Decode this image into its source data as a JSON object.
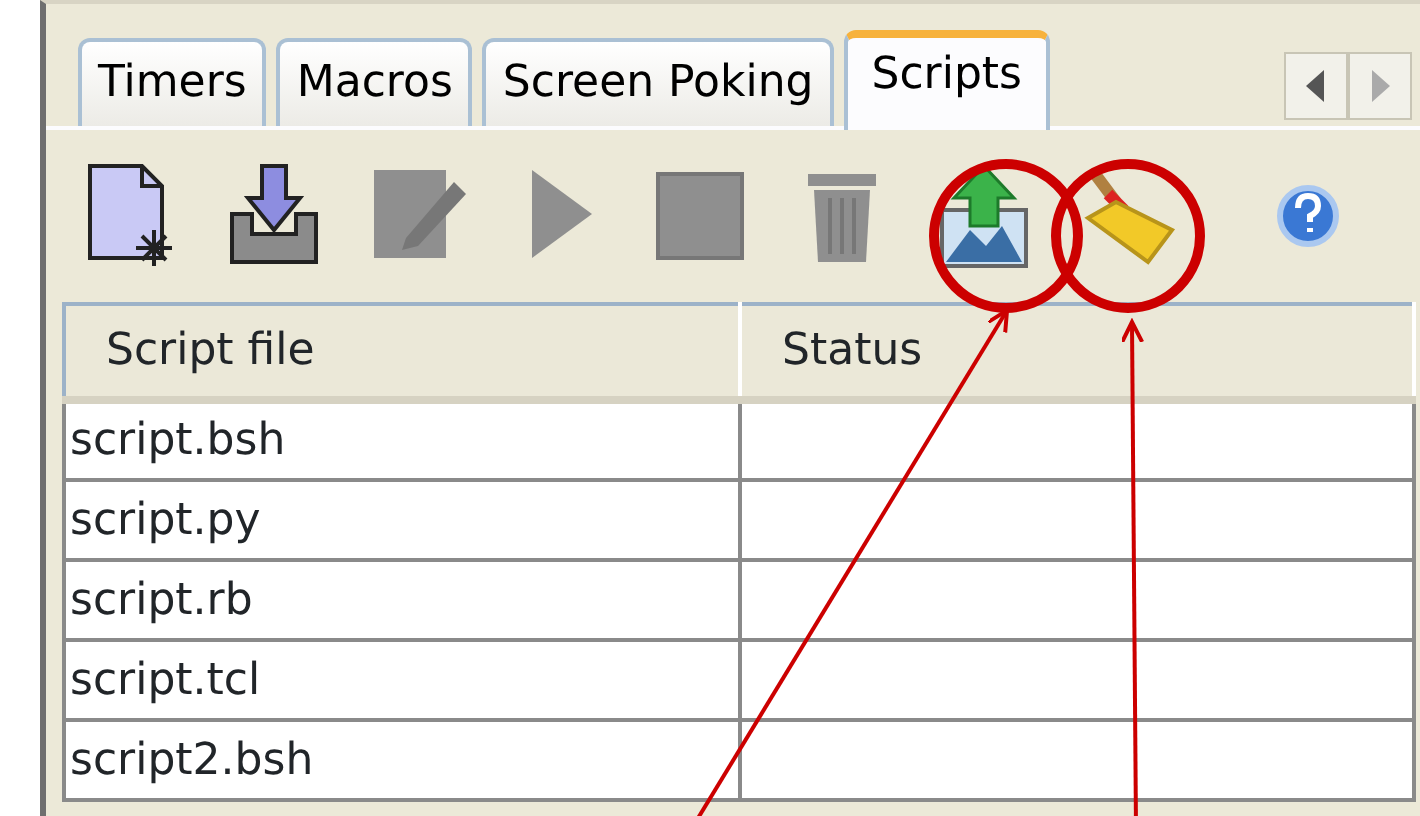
{
  "tabs": [
    {
      "label": "Timers",
      "selected": false
    },
    {
      "label": "Macros",
      "selected": false
    },
    {
      "label": "Screen Poking",
      "selected": false
    },
    {
      "label": "Scripts",
      "selected": true
    }
  ],
  "toolbar": [
    {
      "kind": "new",
      "disabled": false
    },
    {
      "kind": "import",
      "disabled": false
    },
    {
      "kind": "edit",
      "disabled": true
    },
    {
      "kind": "run",
      "disabled": true
    },
    {
      "kind": "stop",
      "disabled": true
    },
    {
      "kind": "delete",
      "disabled": true
    },
    {
      "kind": "upload",
      "disabled": false
    },
    {
      "kind": "clean",
      "disabled": false
    },
    {
      "kind": "help",
      "disabled": false
    }
  ],
  "table": {
    "columns": [
      "Script file",
      "Status"
    ],
    "rows": [
      {
        "file": "script.bsh"
      },
      {
        "file": "script.py"
      },
      {
        "file": "script.rb"
      },
      {
        "file": "script.tcl"
      },
      {
        "file": "script2.bsh"
      }
    ]
  },
  "callouts": [
    {
      "kind": "circle"
    },
    {
      "kind": "circle"
    },
    {
      "kind": "arrow"
    },
    {
      "kind": "arrow"
    }
  ]
}
